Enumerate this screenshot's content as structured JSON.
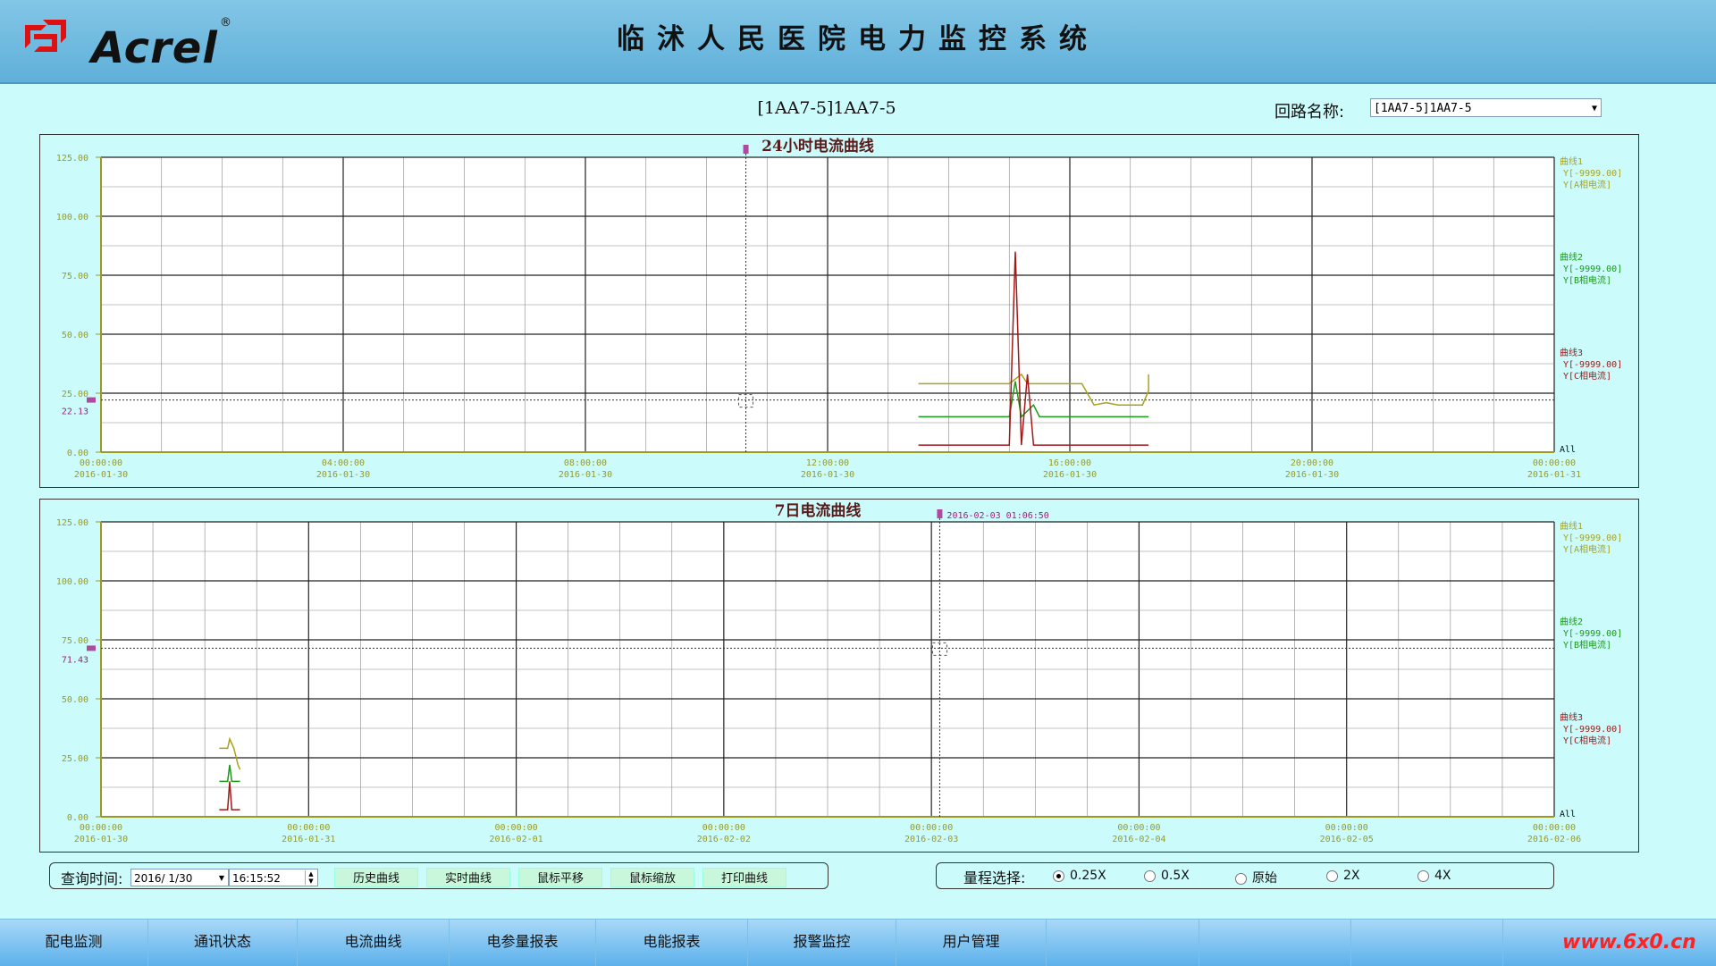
{
  "header": {
    "brand": "Acrel",
    "brand_reg": "®",
    "system_title": "临沭人民医院电力监控系统"
  },
  "loop": {
    "center_title": "[1AA7-5]1AA7-5",
    "label": "回路名称:",
    "selected": "[1AA7-5]1AA7-5"
  },
  "chart_data": [
    {
      "type": "line",
      "title": "24小时电流曲线",
      "ylim": [
        0,
        125
      ],
      "yticks": [
        "125.00",
        "100.00",
        "75.00",
        "50.00",
        "25.00",
        "0.00"
      ],
      "y_marker_value": "22.13",
      "x_ticks": [
        {
          "time": "00:00:00",
          "date": "2016-01-30"
        },
        {
          "time": "04:00:00",
          "date": "2016-01-30"
        },
        {
          "time": "08:00:00",
          "date": "2016-01-30"
        },
        {
          "time": "12:00:00",
          "date": "2016-01-30"
        },
        {
          "time": "16:00:00",
          "date": "2016-01-30"
        },
        {
          "time": "20:00:00",
          "date": "2016-01-30"
        },
        {
          "time": "00:00:00",
          "date": "2016-01-31"
        }
      ],
      "xlim_hours": [
        0,
        24
      ],
      "legend": [
        {
          "name": "曲线1",
          "y": "Y[-9999.00]",
          "desc": "Y[A相电流]",
          "color": "#a9a31a"
        },
        {
          "name": "曲线2",
          "y": "Y[-9999.00]",
          "desc": "Y[B相电流]",
          "color": "#1a9a1a"
        },
        {
          "name": "曲线3",
          "y": "Y[-9999.00]",
          "desc": "Y[C相电流]",
          "color": "#a01a1a"
        }
      ],
      "legend_all": "All",
      "series": [
        {
          "name": "曲线1",
          "color": "#a9a31a",
          "points": [
            [
              13.5,
              29
            ],
            [
              15.0,
              29
            ],
            [
              15.2,
              33
            ],
            [
              15.3,
              29
            ],
            [
              16.2,
              29
            ],
            [
              16.4,
              20
            ],
            [
              16.6,
              21
            ],
            [
              16.8,
              20
            ],
            [
              17.2,
              20
            ],
            [
              17.3,
              26
            ],
            [
              17.3,
              33
            ]
          ]
        },
        {
          "name": "曲线2",
          "color": "#1a9a1a",
          "points": [
            [
              13.5,
              15
            ],
            [
              15.0,
              15
            ],
            [
              15.1,
              30
            ],
            [
              15.2,
              15
            ],
            [
              15.4,
              20
            ],
            [
              15.5,
              15
            ],
            [
              17.3,
              15
            ]
          ]
        },
        {
          "name": "曲线3",
          "color": "#a01a1a",
          "points": [
            [
              13.5,
              3
            ],
            [
              15.0,
              3
            ],
            [
              15.1,
              85
            ],
            [
              15.2,
              3
            ],
            [
              15.3,
              33
            ],
            [
              15.4,
              3
            ],
            [
              17.3,
              3
            ]
          ]
        }
      ]
    },
    {
      "type": "line",
      "title": "7日电流曲线",
      "cursor_label": "2016-02-03 01:06:50",
      "ylim": [
        0,
        125
      ],
      "yticks": [
        "125.00",
        "100.00",
        "75.00",
        "50.00",
        "25.00",
        "0.00"
      ],
      "y_marker_value": "71.43",
      "x_ticks": [
        {
          "time": "00:00:00",
          "date": "2016-01-30"
        },
        {
          "time": "00:00:00",
          "date": "2016-01-31"
        },
        {
          "time": "00:00:00",
          "date": "2016-02-01"
        },
        {
          "time": "00:00:00",
          "date": "2016-02-02"
        },
        {
          "time": "00:00:00",
          "date": "2016-02-03"
        },
        {
          "time": "00:00:00",
          "date": "2016-02-04"
        },
        {
          "time": "00:00:00",
          "date": "2016-02-05"
        },
        {
          "time": "00:00:00",
          "date": "2016-02-06"
        }
      ],
      "xlim_days": [
        0,
        7
      ],
      "legend": [
        {
          "name": "曲线1",
          "y": "Y[-9999.00]",
          "desc": "Y[A相电流]",
          "color": "#a9a31a"
        },
        {
          "name": "曲线2",
          "y": "Y[-9999.00]",
          "desc": "Y[B相电流]",
          "color": "#1a9a1a"
        },
        {
          "name": "曲线3",
          "y": "Y[-9999.00]",
          "desc": "Y[C相电流]",
          "color": "#a01a1a"
        }
      ],
      "legend_all": "All",
      "series": [
        {
          "name": "曲线1",
          "color": "#a9a31a",
          "points": [
            [
              0.57,
              29
            ],
            [
              0.61,
              29
            ],
            [
              0.62,
              33
            ],
            [
              0.64,
              29
            ],
            [
              0.66,
              22
            ],
            [
              0.67,
              20
            ]
          ]
        },
        {
          "name": "曲线2",
          "color": "#1a9a1a",
          "points": [
            [
              0.57,
              15
            ],
            [
              0.61,
              15
            ],
            [
              0.62,
              22
            ],
            [
              0.63,
              15
            ],
            [
              0.67,
              15
            ]
          ]
        },
        {
          "name": "曲线3",
          "color": "#a01a1a",
          "points": [
            [
              0.57,
              3
            ],
            [
              0.61,
              3
            ],
            [
              0.62,
              15
            ],
            [
              0.63,
              3
            ],
            [
              0.67,
              3
            ]
          ]
        }
      ]
    }
  ],
  "query": {
    "label": "查询时间:",
    "date": "2016/ 1/30",
    "time": "16:15:52",
    "buttons": [
      "历史曲线",
      "实时曲线",
      "鼠标平移",
      "鼠标缩放",
      "打印曲线"
    ]
  },
  "range": {
    "label": "量程选择:",
    "options": [
      "0.25X",
      "0.5X",
      "原始",
      "2X",
      "4X"
    ],
    "selected_index": 0
  },
  "nav": {
    "items": [
      "配电监测",
      "通讯状态",
      "电流曲线",
      "电参量报表",
      "电能报表",
      "报警监控",
      "用户管理",
      "",
      "",
      "",
      ""
    ]
  },
  "watermark": "www.6x0.cn"
}
